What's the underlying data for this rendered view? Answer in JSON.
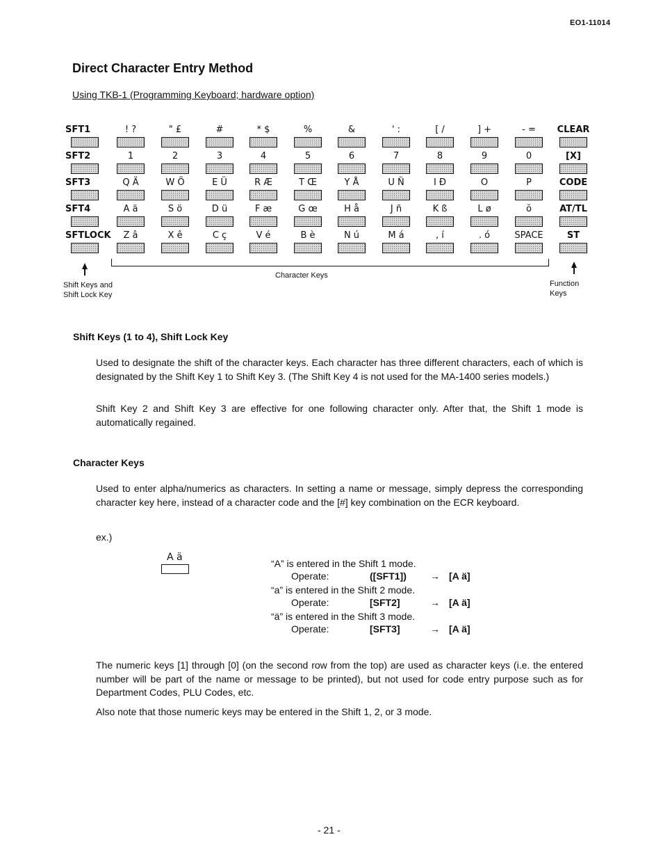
{
  "header": {
    "doc_number": "EO1-11014"
  },
  "title": "Direct Character Entry Method",
  "subtitle": "Using TKB-1 (Programming Keyboard; hardware option)",
  "keyboard": {
    "rows": [
      {
        "shift": "SFT1",
        "keys": [
          "! ?",
          "\" £",
          "#",
          "* $",
          "%",
          "&",
          "' :",
          "[ /",
          "] +",
          "- ="
        ],
        "function": "CLEAR"
      },
      {
        "shift": "SFT2",
        "keys": [
          "1",
          "2",
          "3",
          "4",
          "5",
          "6",
          "7",
          "8",
          "9",
          "0"
        ],
        "function": "[X]"
      },
      {
        "shift": "SFT3",
        "keys": [
          "Q Ä",
          "W Ö",
          "E Ü",
          "R Æ",
          "T Œ",
          "Y Å",
          "U Ñ",
          "I Đ",
          "O",
          "P"
        ],
        "function": "CODE"
      },
      {
        "shift": "SFT4",
        "keys": [
          "A ä",
          "S ö",
          "D ü",
          "F æ",
          "G œ",
          "H å",
          "J ñ",
          "K ß",
          "L ø",
          "ŏ"
        ],
        "function": "AT/TL"
      },
      {
        "shift": "SFTLOCK",
        "keys": [
          "Z â",
          "X ê",
          "C ç",
          "V é",
          "B è",
          "N ú",
          "M á",
          ", í",
          ". ó",
          "SPACE"
        ],
        "function": "ST"
      }
    ],
    "captions": {
      "shift_keys": [
        "Shift Keys  and",
        "Shift Lock Key"
      ],
      "character_keys": "Character Keys",
      "function_keys": [
        "Function",
        "Keys"
      ]
    }
  },
  "sections": {
    "shift": {
      "heading": "Shift Keys (1 to 4), Shift Lock Key",
      "p1": "Used to designate the shift of the character keys.  Each character has three different characters, each of which is designated by the Shift Key 1 to Shift Key 3.  (The Shift Key 4 is not used for the MA-1400 series models.)",
      "p2": "Shift Key 2 and Shift Key 3 are effective for one following character only.  After that, the Shift 1 mode is automatically regained."
    },
    "character": {
      "heading": "Character Keys",
      "p1": "Used to enter alpha/numerics as characters.  In setting a name or message, simply depress the corresponding character key here, instead of a character code and the [#] key combination on the ECR keyboard.",
      "ex_label": "ex.)",
      "example_key": "A  ä",
      "example": [
        {
          "desc": "“A” is entered in the Shift 1 mode.",
          "operate": "Operate:",
          "key": "([SFT1])",
          "arrow": "→",
          "result": "[A  ä]"
        },
        {
          "desc": "“a” is entered in the Shift 2 mode.",
          "operate": "Operate:",
          "key": "[SFT2]",
          "arrow": "→",
          "result": "[A  ä]"
        },
        {
          "desc": "“ä” is entered in the Shift 3 mode.",
          "operate": "Operate:",
          "key": "[SFT3]",
          "arrow": "→",
          "result": "[A  ä]"
        }
      ],
      "p2": "The numeric keys [1] through [0] (on the second row from the top) are used as character keys (i.e. the entered number will be part of the name or message to be printed), but not used for code entry purpose such as for Department Codes, PLU Codes, etc.",
      "p3": "Also note that those numeric keys may be entered in the Shift 1, 2, or 3 mode."
    }
  },
  "footer": {
    "page_number": "- 21 -"
  }
}
